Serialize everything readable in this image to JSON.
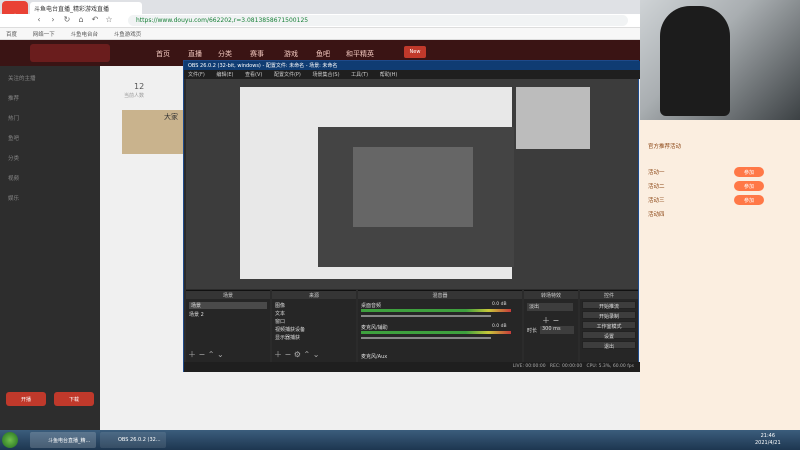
{
  "browser": {
    "tab_title": "斗鱼电台直播_精彩游戏直播",
    "url": "https://www.douyu.com/662202,r=3.0813858671500125",
    "bookmarks": [
      "百度",
      "网络一下",
      "斗鱼电台台",
      "斗鱼游戏页"
    ]
  },
  "site": {
    "nav": [
      "首页",
      "直播",
      "分类",
      "赛事",
      "游戏",
      "鱼吧",
      "和平精英"
    ],
    "tag": "New",
    "room_count": "12",
    "room_label": "当前人数",
    "room_title": "大家",
    "sidebar_items": [
      "关注的主播",
      "推荐",
      "热门",
      "鱼吧",
      "分类",
      "视频",
      "娱乐"
    ],
    "chat_tip_buttons": [
      "开播",
      "下载"
    ]
  },
  "right_panel": {
    "title": "官方推荐活动",
    "rows": [
      "活动一",
      "活动二",
      "活动三",
      "活动四"
    ],
    "btn": "参加"
  },
  "obs": {
    "title": "OBS 26.0.2 (32-bit, windows) - 配置文件: 未命名 - 场景: 未命名",
    "menu": [
      "文件(F)",
      "编辑(E)",
      "查看(V)",
      "配置文件(P)",
      "场景集合(S)",
      "工具(T)",
      "帮助(H)"
    ],
    "docks": {
      "scenes": {
        "title": "场景",
        "items": [
          "场景",
          "场景 2"
        ]
      },
      "sources": {
        "title": "来源",
        "items": [
          "图像",
          "文本",
          "窗口",
          "视频捕获设备",
          "显示器捕获"
        ]
      },
      "mixer": {
        "title": "混音器",
        "ch1": "桌面音频",
        "ch1_db": "0.0 dB",
        "ch2": "麦克风/辅助",
        "ch2_db": "0.0 dB",
        "ch3": "麦克风/Aux"
      },
      "transitions": {
        "title": "转场特效",
        "mode": "淡出",
        "duration_label": "时长",
        "duration": "300 ms"
      },
      "controls": {
        "title": "控件",
        "buttons": [
          "开始推流",
          "开始录制",
          "工作室模式",
          "设置",
          "退出"
        ]
      }
    },
    "status": {
      "live": "LIVE: 00:00:00",
      "rec": "REC: 00:00:00",
      "cpu": "CPU: 5.3%, 60.00 fps"
    }
  },
  "taskbar": {
    "items": [
      "斗鱼电台直播_精...",
      "OBS 26.0.2 (32..."
    ],
    "time": "21:46",
    "date": "2021/4/21"
  }
}
